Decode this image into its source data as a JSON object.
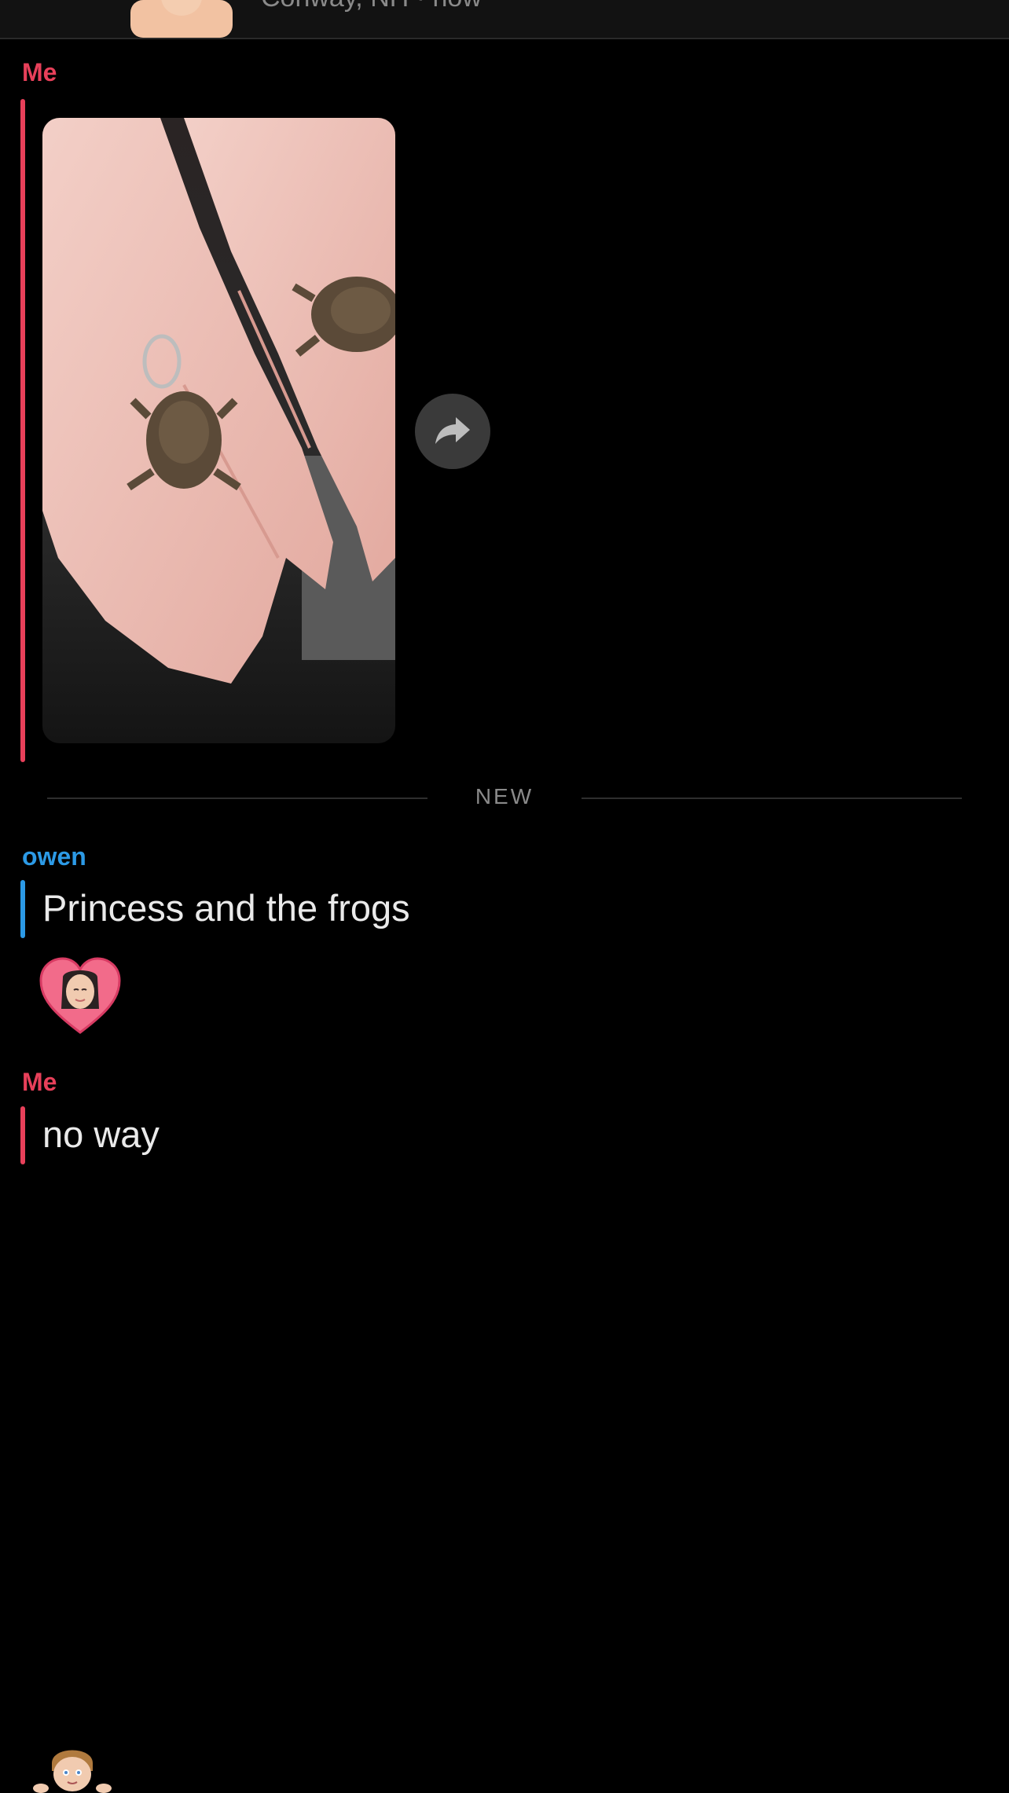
{
  "header": {
    "subtitle": "Conway, NH · now"
  },
  "messages": [
    {
      "sender": "Me",
      "type": "photo",
      "sender_color": "#e8405a"
    },
    {
      "sender": "owen",
      "type": "text",
      "text": "Princess and the frogs",
      "sender_color": "#2c9ae6"
    },
    {
      "sender": "Me",
      "type": "text",
      "text": "no way",
      "sender_color": "#e8405a"
    }
  ],
  "divider": {
    "label": "NEW"
  },
  "icons": {
    "share": "share-arrow-icon",
    "reaction": "heart-bitmoji-reaction-icon",
    "bottom_avatar": "bitmoji-avatar-icon"
  }
}
